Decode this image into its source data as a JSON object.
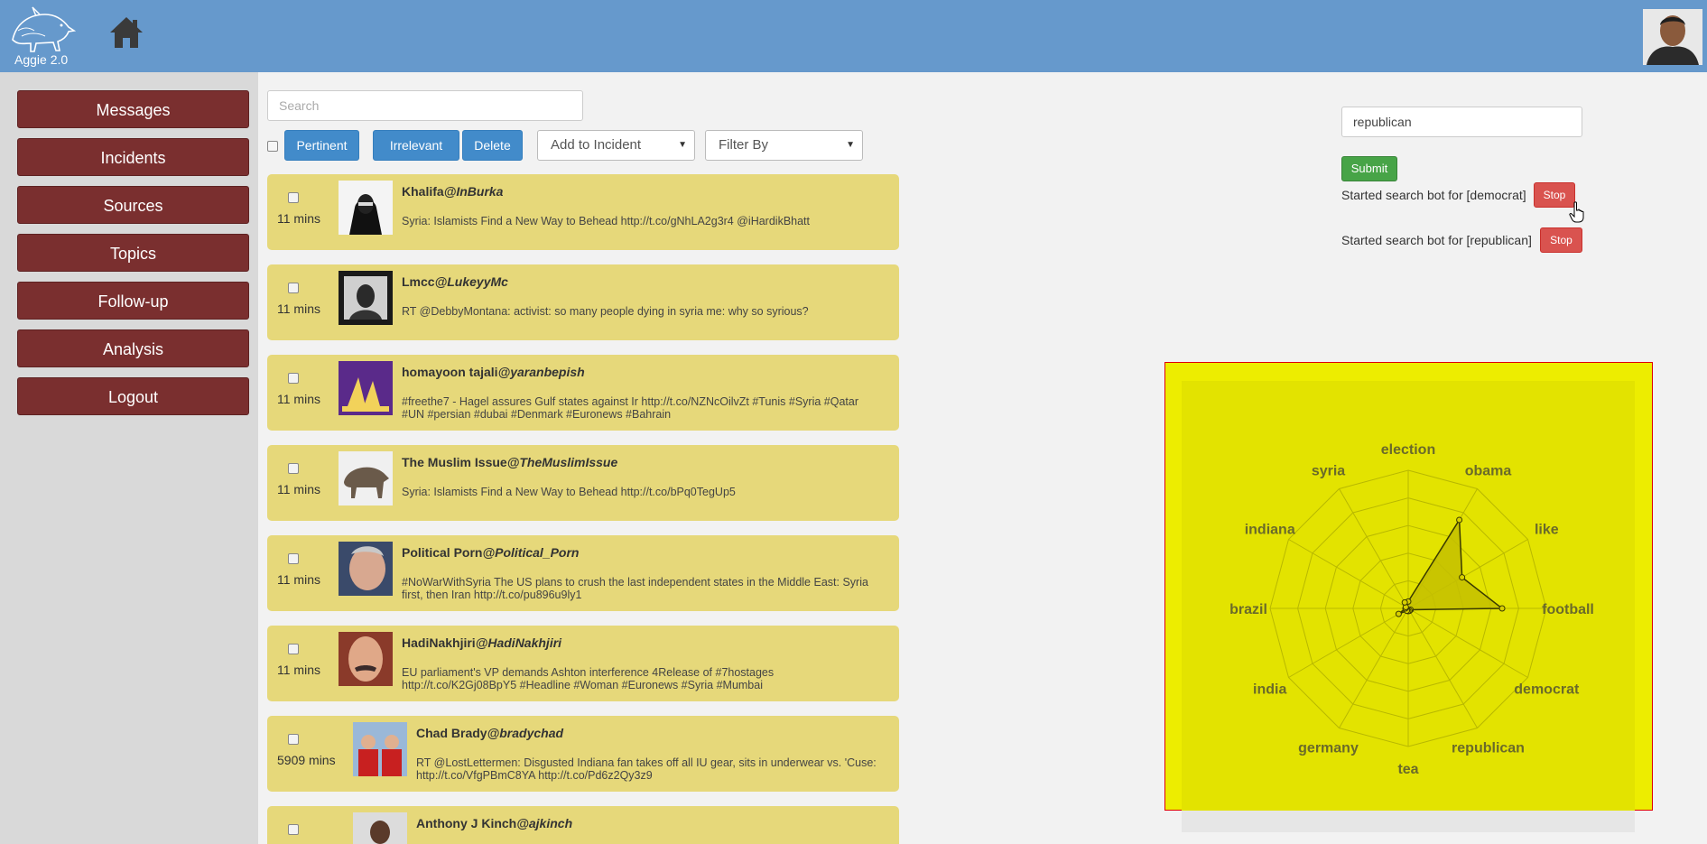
{
  "app": {
    "logo_text": "Aggie 2.0",
    "logo_icon": "aardvark-icon",
    "home_icon": "home-icon"
  },
  "sidebar": {
    "items": [
      {
        "label": "Messages"
      },
      {
        "label": "Incidents"
      },
      {
        "label": "Sources"
      },
      {
        "label": "Topics"
      },
      {
        "label": "Follow-up"
      },
      {
        "label": "Analysis"
      },
      {
        "label": "Logout"
      }
    ]
  },
  "toolbar": {
    "search_placeholder": "Search",
    "pertinent_label": "Pertinent",
    "irrelevant_label": "Irrelevant",
    "delete_label": "Delete",
    "add_to_incident_label": "Add to Incident",
    "filter_by_label": "Filter By"
  },
  "messages": [
    {
      "time": "11 mins",
      "name": "Khalifa",
      "handle": "@InBurka",
      "text": "Syria: Islamists Find a New Way to Behead http://t.co/gNhLA2g3r4 @iHardikBhatt"
    },
    {
      "time": "11 mins",
      "name": "Lmcc",
      "handle": "@LukeyyMc",
      "text": "RT @DebbyMontana: activist: so many people dying in syria me: why so syrious?"
    },
    {
      "time": "11 mins",
      "name": "homayoon tajali",
      "handle": "@yaranbepish",
      "text": "#freethe7 - Hagel assures Gulf states against Ir http://t.co/NZNcOilvZt #Tunis #Syria #Qatar #UN #persian #dubai #Denmark #Euronews #Bahrain"
    },
    {
      "time": "11 mins",
      "name": "The Muslim Issue",
      "handle": "@TheMuslimIssue",
      "text": "Syria: Islamists Find a New Way to Behead http://t.co/bPq0TegUp5"
    },
    {
      "time": "11 mins",
      "name": "Political Porn",
      "handle": "@Political_Porn",
      "text": "#NoWarWithSyria The US plans to crush the last independent states in the Middle East: Syria first, then Iran http://t.co/pu896u9ly1"
    },
    {
      "time": "11 mins",
      "name": "HadiNakhjiri",
      "handle": "@HadiNakhjiri",
      "text": "EU parliament's VP demands Ashton interference 4Release of #7hostages http://t.co/K2Gj08BpY5 #Headline #Woman #Euronews #Syria #Mumbai"
    },
    {
      "time": "5909 mins",
      "name": "Chad Brady",
      "handle": "@bradychad",
      "text": "RT @LostLettermen: Disgusted Indiana fan takes off all IU gear, sits in underwear vs. 'Cuse: http://t.co/VfgPBmC8YA http://t.co/Pd6z2Qy3z9"
    },
    {
      "time": "",
      "name": "Anthony J Kinch",
      "handle": "@ajkinch",
      "text": ""
    }
  ],
  "search_bot": {
    "input_value": "republican",
    "submit_label": "Submit",
    "bots": [
      {
        "text": "Started search bot for [democrat]",
        "stop_label": "Stop"
      },
      {
        "text": "Started search bot for [republican]",
        "stop_label": "Stop"
      }
    ]
  },
  "chart_data": {
    "type": "radar",
    "categories": [
      "election",
      "obama",
      "like",
      "football",
      "democrat",
      "republican",
      "tea",
      "germany",
      "india",
      "brazil",
      "indiana",
      "syria"
    ],
    "values": [
      0.05,
      0.74,
      0.45,
      0.68,
      0.02,
      0.02,
      0.02,
      0.02,
      0.08,
      0.02,
      0.02,
      0.05
    ],
    "levels": 5,
    "range": [
      0,
      1
    ]
  }
}
